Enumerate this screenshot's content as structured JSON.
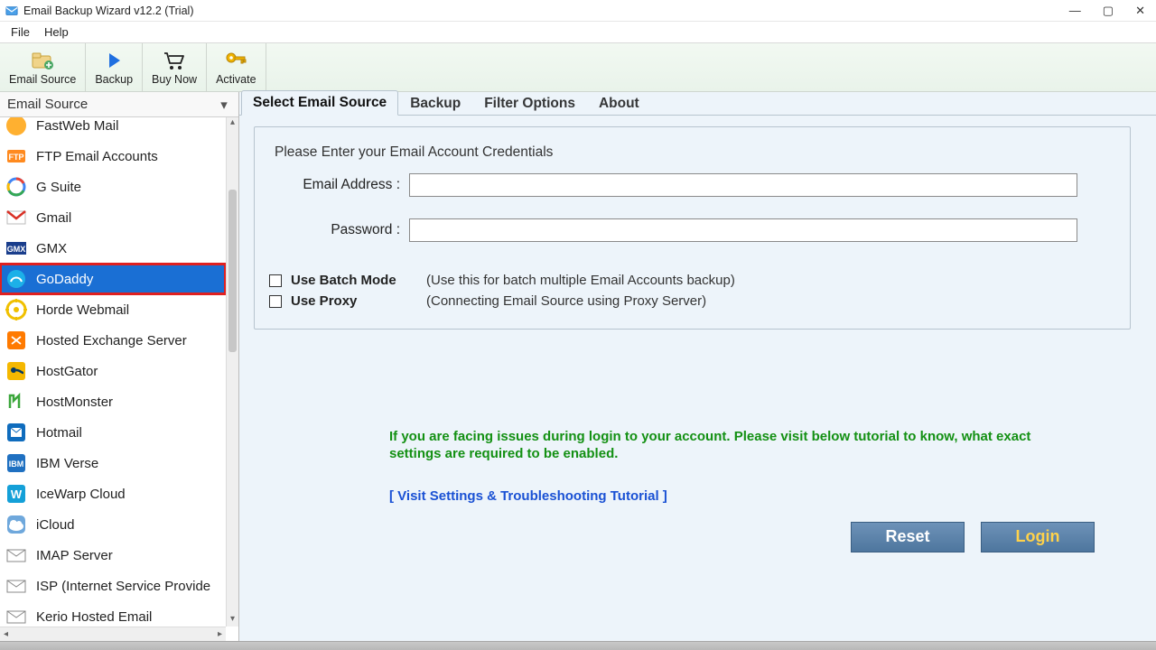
{
  "titlebar": {
    "title": "Email Backup Wizard v12.2 (Trial)"
  },
  "menubar": {
    "file": "File",
    "help": "Help"
  },
  "toolbar": {
    "email_source": "Email Source",
    "backup": "Backup",
    "buy_now": "Buy Now",
    "activate": "Activate"
  },
  "sidebar": {
    "header": "Email Source",
    "items": [
      {
        "label": "FastWeb Mail"
      },
      {
        "label": "FTP Email Accounts"
      },
      {
        "label": "G Suite"
      },
      {
        "label": "Gmail"
      },
      {
        "label": "GMX"
      },
      {
        "label": "GoDaddy"
      },
      {
        "label": "Horde Webmail"
      },
      {
        "label": "Hosted Exchange Server"
      },
      {
        "label": "HostGator"
      },
      {
        "label": "HostMonster"
      },
      {
        "label": "Hotmail"
      },
      {
        "label": "IBM Verse"
      },
      {
        "label": "IceWarp Cloud"
      },
      {
        "label": "iCloud"
      },
      {
        "label": "IMAP Server"
      },
      {
        "label": "ISP (Internet Service Provide"
      },
      {
        "label": "Kerio Hosted Email"
      }
    ],
    "selected_index": 5
  },
  "tabs": {
    "select_email_source": "Select Email Source",
    "backup": "Backup",
    "filter_options": "Filter Options",
    "about": "About"
  },
  "form": {
    "legend": "Please Enter your Email Account Credentials",
    "email_label": "Email Address :",
    "password_label": "Password :",
    "email_value": "",
    "password_value": "",
    "batch": {
      "label": "Use Batch Mode",
      "hint": "(Use this for batch multiple Email Accounts backup)",
      "checked": false
    },
    "proxy": {
      "label": "Use Proxy",
      "hint": "(Connecting Email Source using Proxy Server)",
      "checked": false
    },
    "help_text": "If you are facing issues during login to your account. Please visit below tutorial to know, what exact settings are required to be enabled.",
    "tutorial_link": "[ Visit Settings & Troubleshooting Tutorial ]",
    "reset_btn": "Reset",
    "login_btn": "Login"
  }
}
